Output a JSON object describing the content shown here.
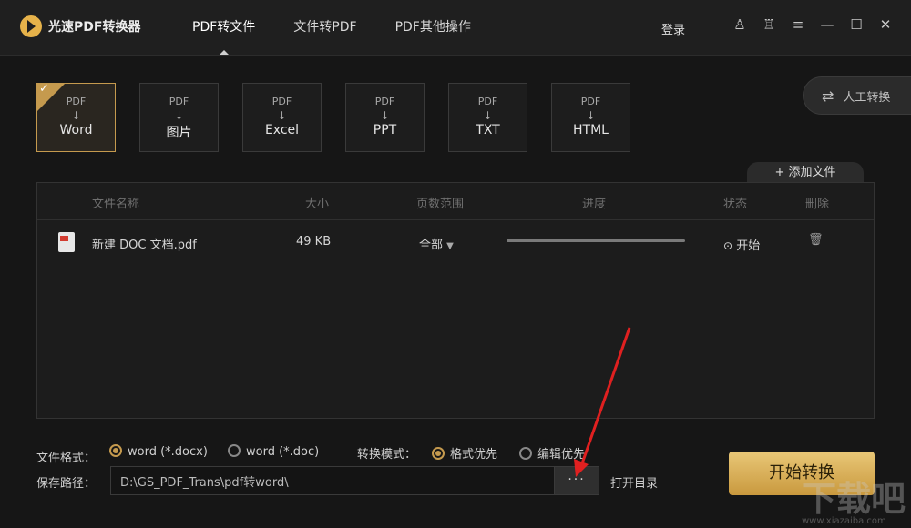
{
  "app": {
    "title": "光速PDF转换器"
  },
  "nav": {
    "tabs": [
      "PDF转文件",
      "文件转PDF",
      "PDF其他操作"
    ],
    "active": 0
  },
  "header": {
    "login": "登录"
  },
  "formats": [
    {
      "from": "PDF",
      "to": "Word",
      "selected": true
    },
    {
      "from": "PDF",
      "to": "图片"
    },
    {
      "from": "PDF",
      "to": "Excel"
    },
    {
      "from": "PDF",
      "to": "PPT"
    },
    {
      "from": "PDF",
      "to": "TXT"
    },
    {
      "from": "PDF",
      "to": "HTML"
    }
  ],
  "manual_button": "人工转换",
  "add_file_button": "+ 添加文件",
  "table": {
    "columns": [
      "文件名称",
      "大小",
      "页数范围",
      "进度",
      "状态",
      "删除"
    ],
    "rows": [
      {
        "name": "新建 DOC 文档.pdf",
        "size": "49 KB",
        "range": "全部",
        "progress": 0,
        "status": "开始"
      }
    ]
  },
  "options": {
    "format_label": "文件格式：",
    "format_options": [
      "word (*.docx)",
      "word (*.doc)"
    ],
    "format_selected": 0,
    "mode_label": "转换模式：",
    "mode_options": [
      "格式优先",
      "编辑优先"
    ],
    "mode_selected": 0,
    "path_label": "保存路径：",
    "path_value": "D:\\GS_PDF_Trans\\pdf转word\\",
    "browse_label": "···",
    "open_dir": "打开目录"
  },
  "start_button": "开始转换",
  "watermark": {
    "main": "下载吧",
    "sub": "www.xiazaiba.com"
  },
  "colors": {
    "accent": "#c59a4e",
    "background": "#161616",
    "annotation": "#e02020"
  }
}
